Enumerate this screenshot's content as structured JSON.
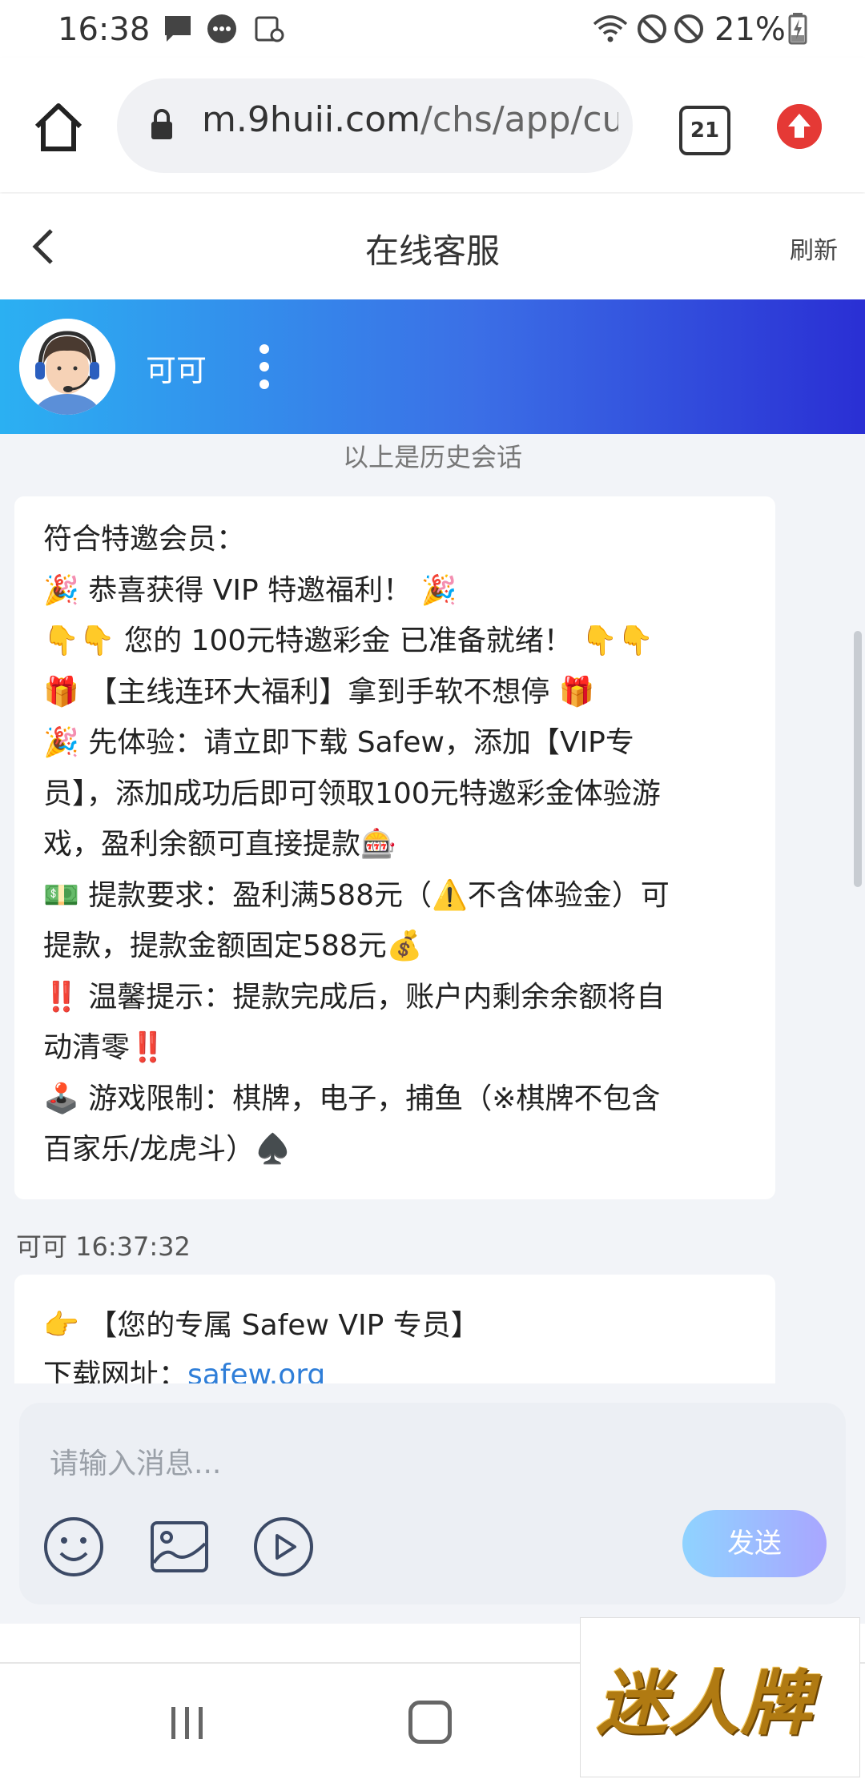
{
  "status_bar": {
    "time": "16:38",
    "battery": "21%"
  },
  "browser": {
    "url_host": "m.9huii.com",
    "url_path": "/chs/app/cu",
    "tab_count": "21"
  },
  "header": {
    "title": "在线客服",
    "refresh": "刷新"
  },
  "agent": {
    "name": "可可"
  },
  "chat": {
    "history_label": "以上是历史会话",
    "message_1_lines": [
      "符合特邀会员：",
      "🎉 恭喜获得 VIP 特邀福利！ 🎉",
      "👇👇 您的 100元特邀彩金 已准备就绪！ 👇👇",
      "🎁 【主线连环大福利】拿到手软不想停 🎁",
      "🎉 先体验：请立即下载 Safew，添加【VIP专",
      "员】，添加成功后即可领取100元特邀彩金体验游",
      "戏，盈利余额可直接提款🎰",
      "💵 提款要求：盈利满588元（⚠️不含体验金）可",
      "提款，提款金额固定588元💰",
      "‼️ 温馨提示：提款完成后，账户内剩余余额将自",
      "动清零‼️",
      "🕹️ 游戏限制：棋牌，电子，捕鱼（※棋牌不包含",
      "百家乐/龙虎斗）♠️"
    ],
    "message_meta": "可可 16:37:32",
    "message_2_line1": "👉 【您的专属 Safew VIP 专员】",
    "message_2_label": "下载网址：",
    "message_2_link": "safew.org"
  },
  "composer": {
    "placeholder": "请输入消息...",
    "send": "发送"
  },
  "watermark": {
    "text": "迷人牌"
  },
  "colors": {
    "banner_start": "#2bb0f2",
    "banner_end": "#2a2fd4",
    "link": "#2f7ed8",
    "send_start": "#8fd3ff",
    "send_end": "#a9a6ff"
  }
}
